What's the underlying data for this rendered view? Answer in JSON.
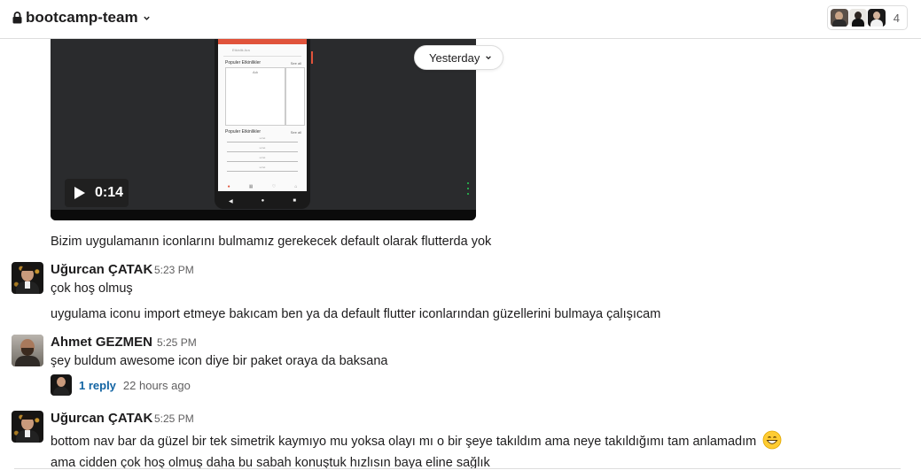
{
  "header": {
    "channel_name": "bootcamp-team",
    "member_count": "4",
    "icons": [
      "lock-icon",
      "chevron-down-icon"
    ]
  },
  "date_divider": {
    "label": "Yesterday"
  },
  "video": {
    "duration": "0:14",
    "phone_screen": {
      "search_text": "Etkinlik Ara",
      "section1_title": "Populer Etkinlikler",
      "section2_title": "Populer Etkinlikler",
      "see_all": "See all",
      "card_label": "Adı",
      "list_item": "ucret"
    }
  },
  "messages": [
    {
      "text": "Bizim uygulamanın iconlarını bulmamız gerekecek default olarak flutterda yok"
    },
    {
      "sender": "Uğurcan ÇATAK",
      "time": "5:23 PM",
      "lines": [
        "çok hoş olmuş",
        "uygulama iconu import etmeye bakıcam ben ya da default flutter iconlarından güzellerini bulmaya çalışıcam"
      ]
    },
    {
      "sender": "Ahmet GEZMEN",
      "time": "5:25 PM",
      "lines": [
        "şey buldum awesome icon diye bir paket oraya da baksana"
      ],
      "thread": {
        "replies": "1 reply",
        "last_reply": "22 hours ago"
      }
    },
    {
      "sender": "Uğurcan ÇATAK",
      "time": "5:25 PM",
      "lines": [
        "bottom nav bar da güzel bir tek simetrik kaymıyo mu yoksa olayı mı o bir şeye takıldım ama neye takıldığımı tam anlamadım",
        "ama cidden çok hoş olmuş daha bu sabah konuştuk hızlısın baya eline sağlık"
      ],
      "emoji": "grinning-face"
    }
  ],
  "colors": {
    "link": "#1264a3",
    "muted": "#616061",
    "text": "#1d1c1d",
    "accent_red": "#e0533b"
  }
}
